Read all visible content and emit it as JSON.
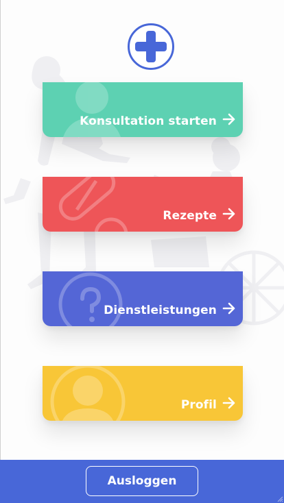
{
  "logo": {
    "icon": "medical-cross-icon",
    "color": "#4867d8"
  },
  "menu": {
    "items": [
      {
        "label": "Konsultation starten",
        "icon": "doctor-icon",
        "color": "#5dd1b2"
      },
      {
        "label": "Rezepte",
        "icon": "pill-icon",
        "color": "#ee5558"
      },
      {
        "label": "Dienstleistungen",
        "icon": "question-icon",
        "color": "#5466d6"
      },
      {
        "label": "Profil",
        "icon": "user-icon",
        "color": "#f8c637"
      }
    ],
    "arrow_icon": "arrow-right-icon"
  },
  "footer": {
    "logout_label": "Ausloggen",
    "color": "#4867d8"
  }
}
